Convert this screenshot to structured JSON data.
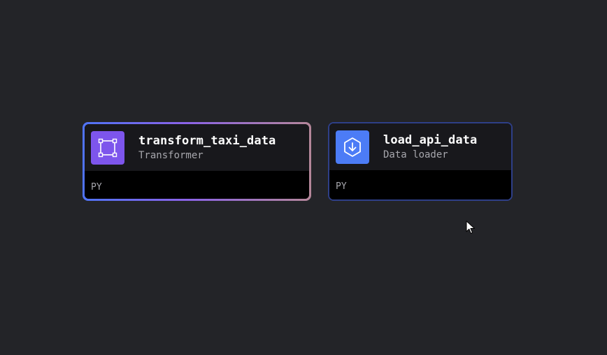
{
  "blocks": [
    {
      "name": "transform_taxi_data",
      "type": "Transformer",
      "language": "PY",
      "icon": "transformer-square-icon",
      "icon_color": "#7d55ec",
      "selected": true
    },
    {
      "name": "load_api_data",
      "type": "Data loader",
      "language": "PY",
      "icon": "download-hexagon-icon",
      "icon_color": "#4c7cf6",
      "selected": false
    }
  ],
  "colors": {
    "canvas_background": "#232428",
    "selected_border_gradient": [
      "#4f73f5",
      "#8b63e8",
      "#b5879a"
    ],
    "plain_border": "#2e3f88"
  }
}
